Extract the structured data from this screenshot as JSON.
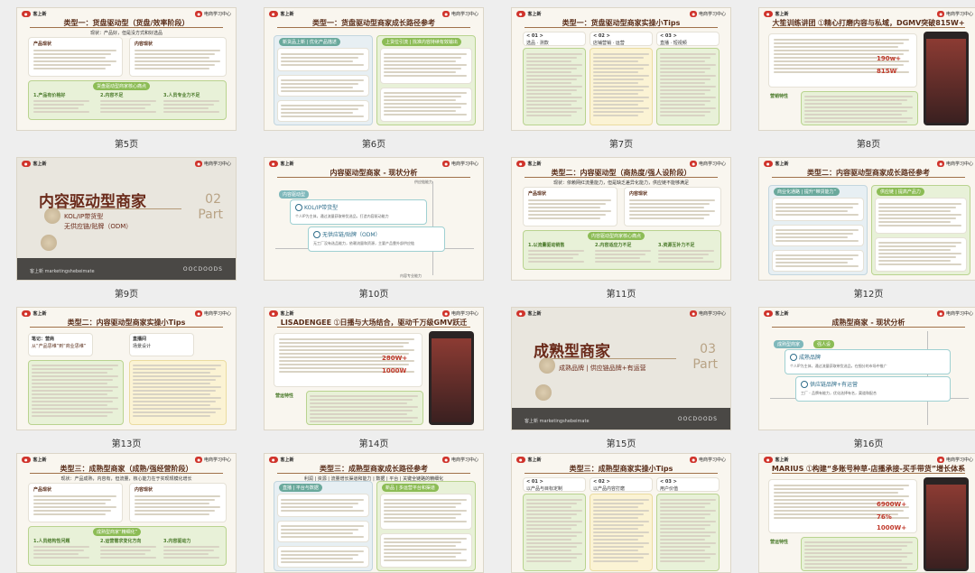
{
  "slides": [
    {
      "label": "第5页",
      "brand": "客上新",
      "tag": "电商学习中心",
      "title": "类型一：货盘驱动型（货盘/效率阶段）",
      "subtitle": "现状：产品好，但是没方式和好选品",
      "h1": "产品现状",
      "h2": "内容现状",
      "band": "货盘驱动型商家核心痛点",
      "c1": "1.产品有价格好",
      "c2": "2.内容不足",
      "c3": "3.人员专业力不足"
    },
    {
      "label": "第6页",
      "brand": "客上新",
      "tag": "电商学习中心",
      "title": "类型一：货盘驱动型商家成长路径参考",
      "left": "新货品上新 | 优化产品描述",
      "right": "上货位引流 | 找准内容持续有效输出"
    },
    {
      "label": "第7页",
      "brand": "客上新",
      "tag": "电商学习中心",
      "title": "类型一：货盘驱动型商家实操小Tips",
      "t1": "< 01 >",
      "t1b": "选品 · 测款",
      "t2": "< 02 >",
      "t2b": "店铺营销 · 运营",
      "t3": "< 03 >",
      "t3b": "直播 · 短视频"
    },
    {
      "label": "第8页",
      "brand": "客上新",
      "tag": "电商学习中心",
      "title": "大笙训练讲团 ➀精心打磨内容与私域，DGMV突破815W+",
      "stat1": "190w+",
      "stat2": "815W",
      "side": "营销特性"
    },
    {
      "label": "第9页",
      "brand": "客上新",
      "tag": "电商学习中心",
      "big": "内容驱动型商家",
      "sub1": "KOL/IP带货型",
      "sub2": "无供应链/贴牌（ODM）",
      "num": "02",
      "part": "Part",
      "footer_brand": "OOCDOODS",
      "footer_logo": "客上新 marketingshebeimate"
    },
    {
      "label": "第10页",
      "brand": "客上新",
      "tag": "电商学习中心",
      "title": "内容驱动型商家 - 现状分析",
      "head": "内容驱动型",
      "b1": "KOL/IP带货型",
      "b1d": "个人IP为主体，通过流量获取带货选品，打造内容驱动能力",
      "b2": "无供应链/贴牌（ODM）",
      "b2d": "无工厂没有选品能力，依赖流量和资源，主要产品靠外部供应链",
      "ax1": "供应链能力",
      "ax2": "内容专业能力"
    },
    {
      "label": "第11页",
      "brand": "客上新",
      "tag": "电商学习中心",
      "title": "类型二：内容驱动型（商热度/强人设阶段）",
      "subtitle": "现状：依赖网红流量能力，但是缺乏差异化能力，供应链不能够满足",
      "h1": "产品现状",
      "h2": "内容现状",
      "band": "内容驱动型商家核心痛点",
      "c1": "1.以流量驱动销售",
      "c2": "2.内容适应力不足",
      "c3": "3.资源互补力不足"
    },
    {
      "label": "第12页",
      "brand": "客上新",
      "tag": "电商学习中心",
      "title": "类型二：内容驱动型商家成长路径参考",
      "left": "商业化通路 | 提升“带货能力”",
      "right": "供应链 | 提高产品力"
    },
    {
      "label": "第13页",
      "brand": "客上新",
      "tag": "电商学习中心",
      "title": "类型二：内容驱动型商家实操小Tips",
      "n1": "笔记：营商",
      "n1b": "从“产品思维”到“商业思维”",
      "n2": "直播间",
      "n2b": "场景设计"
    },
    {
      "label": "第14页",
      "brand": "客上新",
      "tag": "电商学习中心",
      "title": "LISADENGEE ➀日播与大场结合，驱动千万级GMV跃迁",
      "stat1": "280W+",
      "stat2": "1000W",
      "side": "营运特性"
    },
    {
      "label": "第15页",
      "brand": "客上新",
      "tag": "电商学习中心",
      "big": "成熟型商家",
      "sub1": "成熟品牌 | 供应链品牌+有运营",
      "num": "03",
      "part": "Part",
      "footer_brand": "OOCDOODS",
      "footer_logo": "客上新 marketingshebeimate"
    },
    {
      "label": "第16页",
      "brand": "客上新",
      "tag": "电商学习中心",
      "title": "成熟型商家 - 现状分析",
      "head": "成熟型商家",
      "head2": "强人设",
      "b1": "成熟品牌",
      "b1d": "个人IP为主体，通过流量获取带货选品，在细分的市场中推广",
      "b2": "供应链品牌+有运营",
      "b2d": "工厂 - 品牌有能力，优化选择有名，渠道和配合"
    },
    {
      "label": "",
      "brand": "客上新",
      "tag": "电商学习中心",
      "title": "类型三：成熟型商家（成熟/强经营阶段）",
      "subtitle": "现状：产品成熟，内容有，但流量，核心能力在于实现规模化增长",
      "h1": "产品现状",
      "h2": "内容现状",
      "band": "成熟型商家“精细化”",
      "c1": "1.人员结构性问题",
      "c2": "2.运营需求变化方向",
      "c3": "3.内容驱动力"
    },
    {
      "label": "",
      "brand": "客上新",
      "tag": "电商学习中心",
      "title": "类型三：成熟型商家成长路径参考",
      "subtitle": "利润 | 资源 | 流量增长渠道和能力 | 数据 | 平台 | 关键全链路的精细化",
      "left": "直播 | 平台与数据",
      "right": "新品 | 多运营平台和渠道"
    },
    {
      "label": "",
      "brand": "客上新",
      "tag": "电商学习中心",
      "title": "类型三：成熟型商家实操小Tips",
      "t1": "< 01 >",
      "t1b": "以产品与目标定制",
      "t2": "< 02 >",
      "t2b": "以产品内容打磨",
      "t3": "< 03 >",
      "t3b": "用户价值"
    },
    {
      "label": "",
      "brand": "客上新",
      "tag": "电商学习中心",
      "title": "MARIUS ➀构建“多账号种草-店播承接-买手带货”增长体系",
      "stat1": "6900W+",
      "stat2": "76%",
      "stat3": "1000W+",
      "side": "营运特性"
    }
  ]
}
